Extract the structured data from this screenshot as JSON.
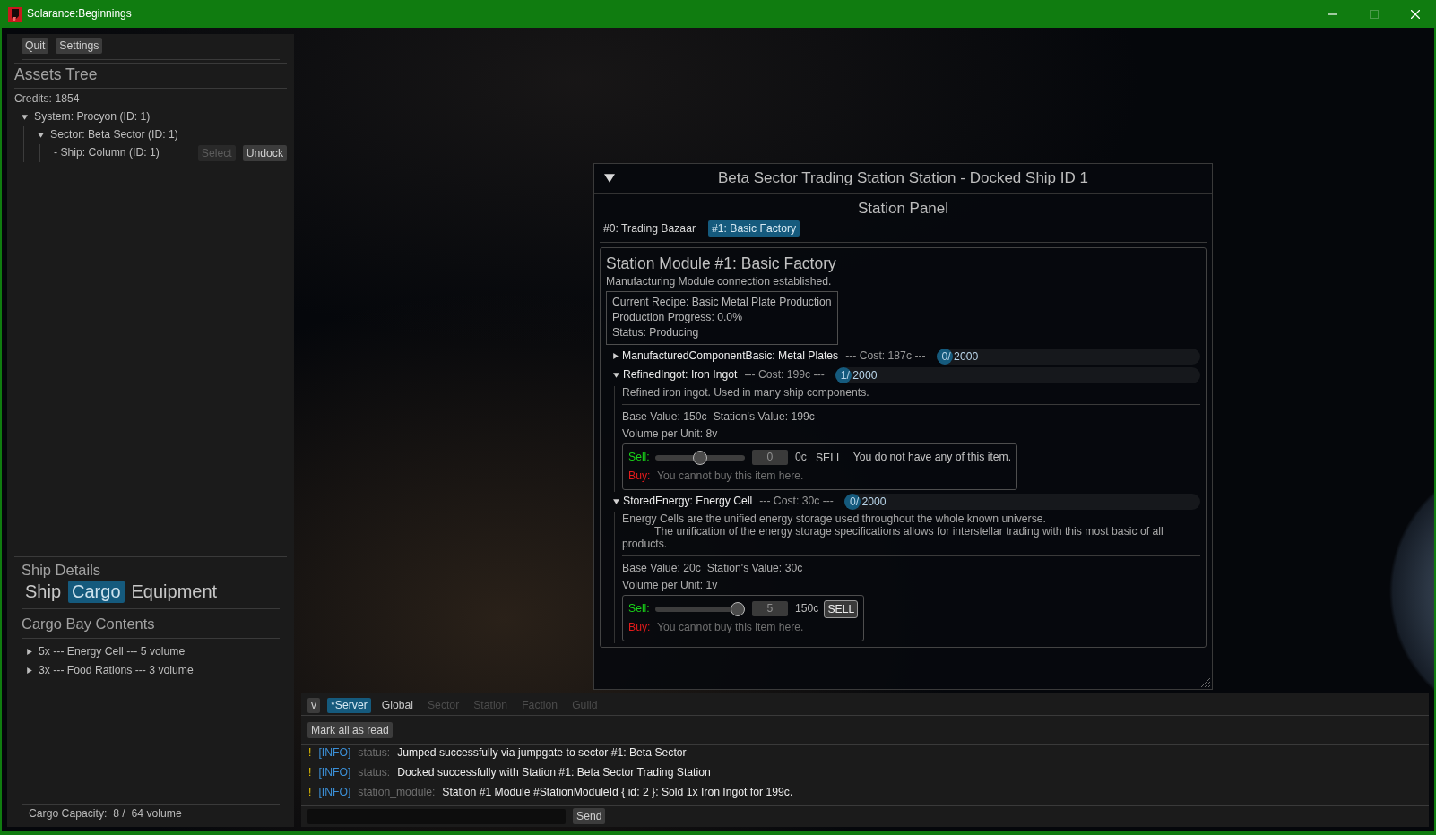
{
  "window": {
    "title": "Solarance:Beginnings",
    "controls": [
      {
        "kind": "minimize",
        "disabled": false
      },
      {
        "kind": "maximize",
        "disabled": true
      },
      {
        "kind": "close",
        "disabled": false
      }
    ]
  },
  "sidebar": {
    "buttons": [
      "Quit",
      "Settings"
    ],
    "assets_tree": {
      "title": "Assets Tree",
      "credits": "Credits: 1854",
      "nodes": [
        {
          "label": "System: Procyon (ID: 1)",
          "expanded": true,
          "children": [
            {
              "label": "Sector: Beta Sector (ID: 1)",
              "expanded": true,
              "children": [
                {
                  "label": "- Ship: Column (ID: 1)",
                  "buttons": [
                    {
                      "label": "Select",
                      "disabled": true
                    },
                    {
                      "label": "Undock",
                      "disabled": false
                    }
                  ]
                }
              ]
            }
          ]
        }
      ]
    },
    "ship_details": {
      "title": "Ship Details",
      "tabs": [
        {
          "label": "Ship",
          "selected": false
        },
        {
          "label": "Cargo",
          "selected": true
        },
        {
          "label": "Equipment",
          "selected": false
        }
      ],
      "section_title": "Cargo Bay Contents",
      "cargo_items": [
        {
          "label": "5x --- Energy Cell --- 5 volume",
          "expanded": false
        },
        {
          "label": "3x --- Food Rations --- 3 volume",
          "expanded": false
        }
      ],
      "capacity": "Cargo Capacity:  8 /  64 volume"
    }
  },
  "station_window": {
    "title": "Beta Sector Trading Station Station - Docked Ship ID 1",
    "expanded": true,
    "panel_title": "Station Panel",
    "tabs": [
      {
        "label": "#0: Trading Bazaar",
        "selected": false
      },
      {
        "label": "#1: Basic Factory",
        "selected": true
      }
    ],
    "module": {
      "title": "Station Module #1: Basic Factory",
      "subtitle": "Manufacturing Module connection established.",
      "recipe_lines": [
        "Current Recipe: Basic Metal Plate Production",
        "Production Progress: 0.0%",
        "Status: Producing"
      ],
      "items": [
        {
          "name": "ManufacturedComponentBasic: Metal Plates",
          "cost": "--- Cost: 187c ---",
          "stock": "0/ 2000",
          "level": 0,
          "expanded": false
        },
        {
          "name": "RefinedIngot: Iron Ingot",
          "cost": "--- Cost: 199c ---",
          "stock": "1/ 2000",
          "level": 0.0005,
          "expanded": true,
          "description": [
            "Refined iron ingot. Used in many ship components."
          ],
          "base_value": "Base Value: 150c",
          "station_value": "Station's Value: 199c",
          "volume": "Volume per Unit: 8v",
          "sell": {
            "label": "Sell:",
            "level": 0.5,
            "quantity": "0",
            "price": "0c",
            "button": {
              "label": "SELL",
              "disabled": true
            },
            "note": "You do not have any of this item."
          },
          "buy": {
            "label": "Buy:",
            "note": "You cannot buy this item here."
          }
        },
        {
          "name": "StoredEnergy: Energy Cell",
          "cost": "--- Cost: 30c ---",
          "stock": "0/ 2000",
          "level": 0,
          "expanded": true,
          "description": [
            "Energy Cells are the unified energy storage used throughout the whole known universe.",
            "The unification of the energy storage specifications allows for interstellar trading with this most basic of all products."
          ],
          "base_value": "Base Value: 20c",
          "station_value": "Station's Value: 30c",
          "volume": "Volume per Unit: 1v",
          "sell": {
            "label": "Sell:",
            "level": 1,
            "quantity": "5",
            "price": "150c",
            "button": {
              "label": "SELL",
              "disabled": false
            }
          },
          "buy": {
            "label": "Buy:",
            "note": "You cannot buy this item here."
          }
        }
      ]
    }
  },
  "chat": {
    "collapse_button": "v",
    "tabs": [
      {
        "label": "*Server",
        "selected": true,
        "disabled": false
      },
      {
        "label": "Global",
        "selected": false,
        "disabled": false
      },
      {
        "label": "Sector",
        "selected": false,
        "disabled": true
      },
      {
        "label": "Station",
        "selected": false,
        "disabled": true
      },
      {
        "label": "Faction",
        "selected": false,
        "disabled": true
      },
      {
        "label": "Guild",
        "selected": false,
        "disabled": true
      }
    ],
    "mark_read_button": "Mark all as read",
    "messages": [
      {
        "marker": "!",
        "level": "[INFO]",
        "source": "status:",
        "text": "Jumped successfully via jumpgate to sector #1: Beta Sector"
      },
      {
        "marker": "!",
        "level": "[INFO]",
        "source": "status:",
        "text": "Docked successfully with Station #1: Beta Sector Trading Station"
      },
      {
        "marker": "!",
        "level": "[INFO]",
        "source": "station_module:",
        "text": "Station #1 Module #StationModuleId { id: 2 }: Sold 1x Iron Ingot for 199c."
      }
    ],
    "send_button": "Send"
  }
}
